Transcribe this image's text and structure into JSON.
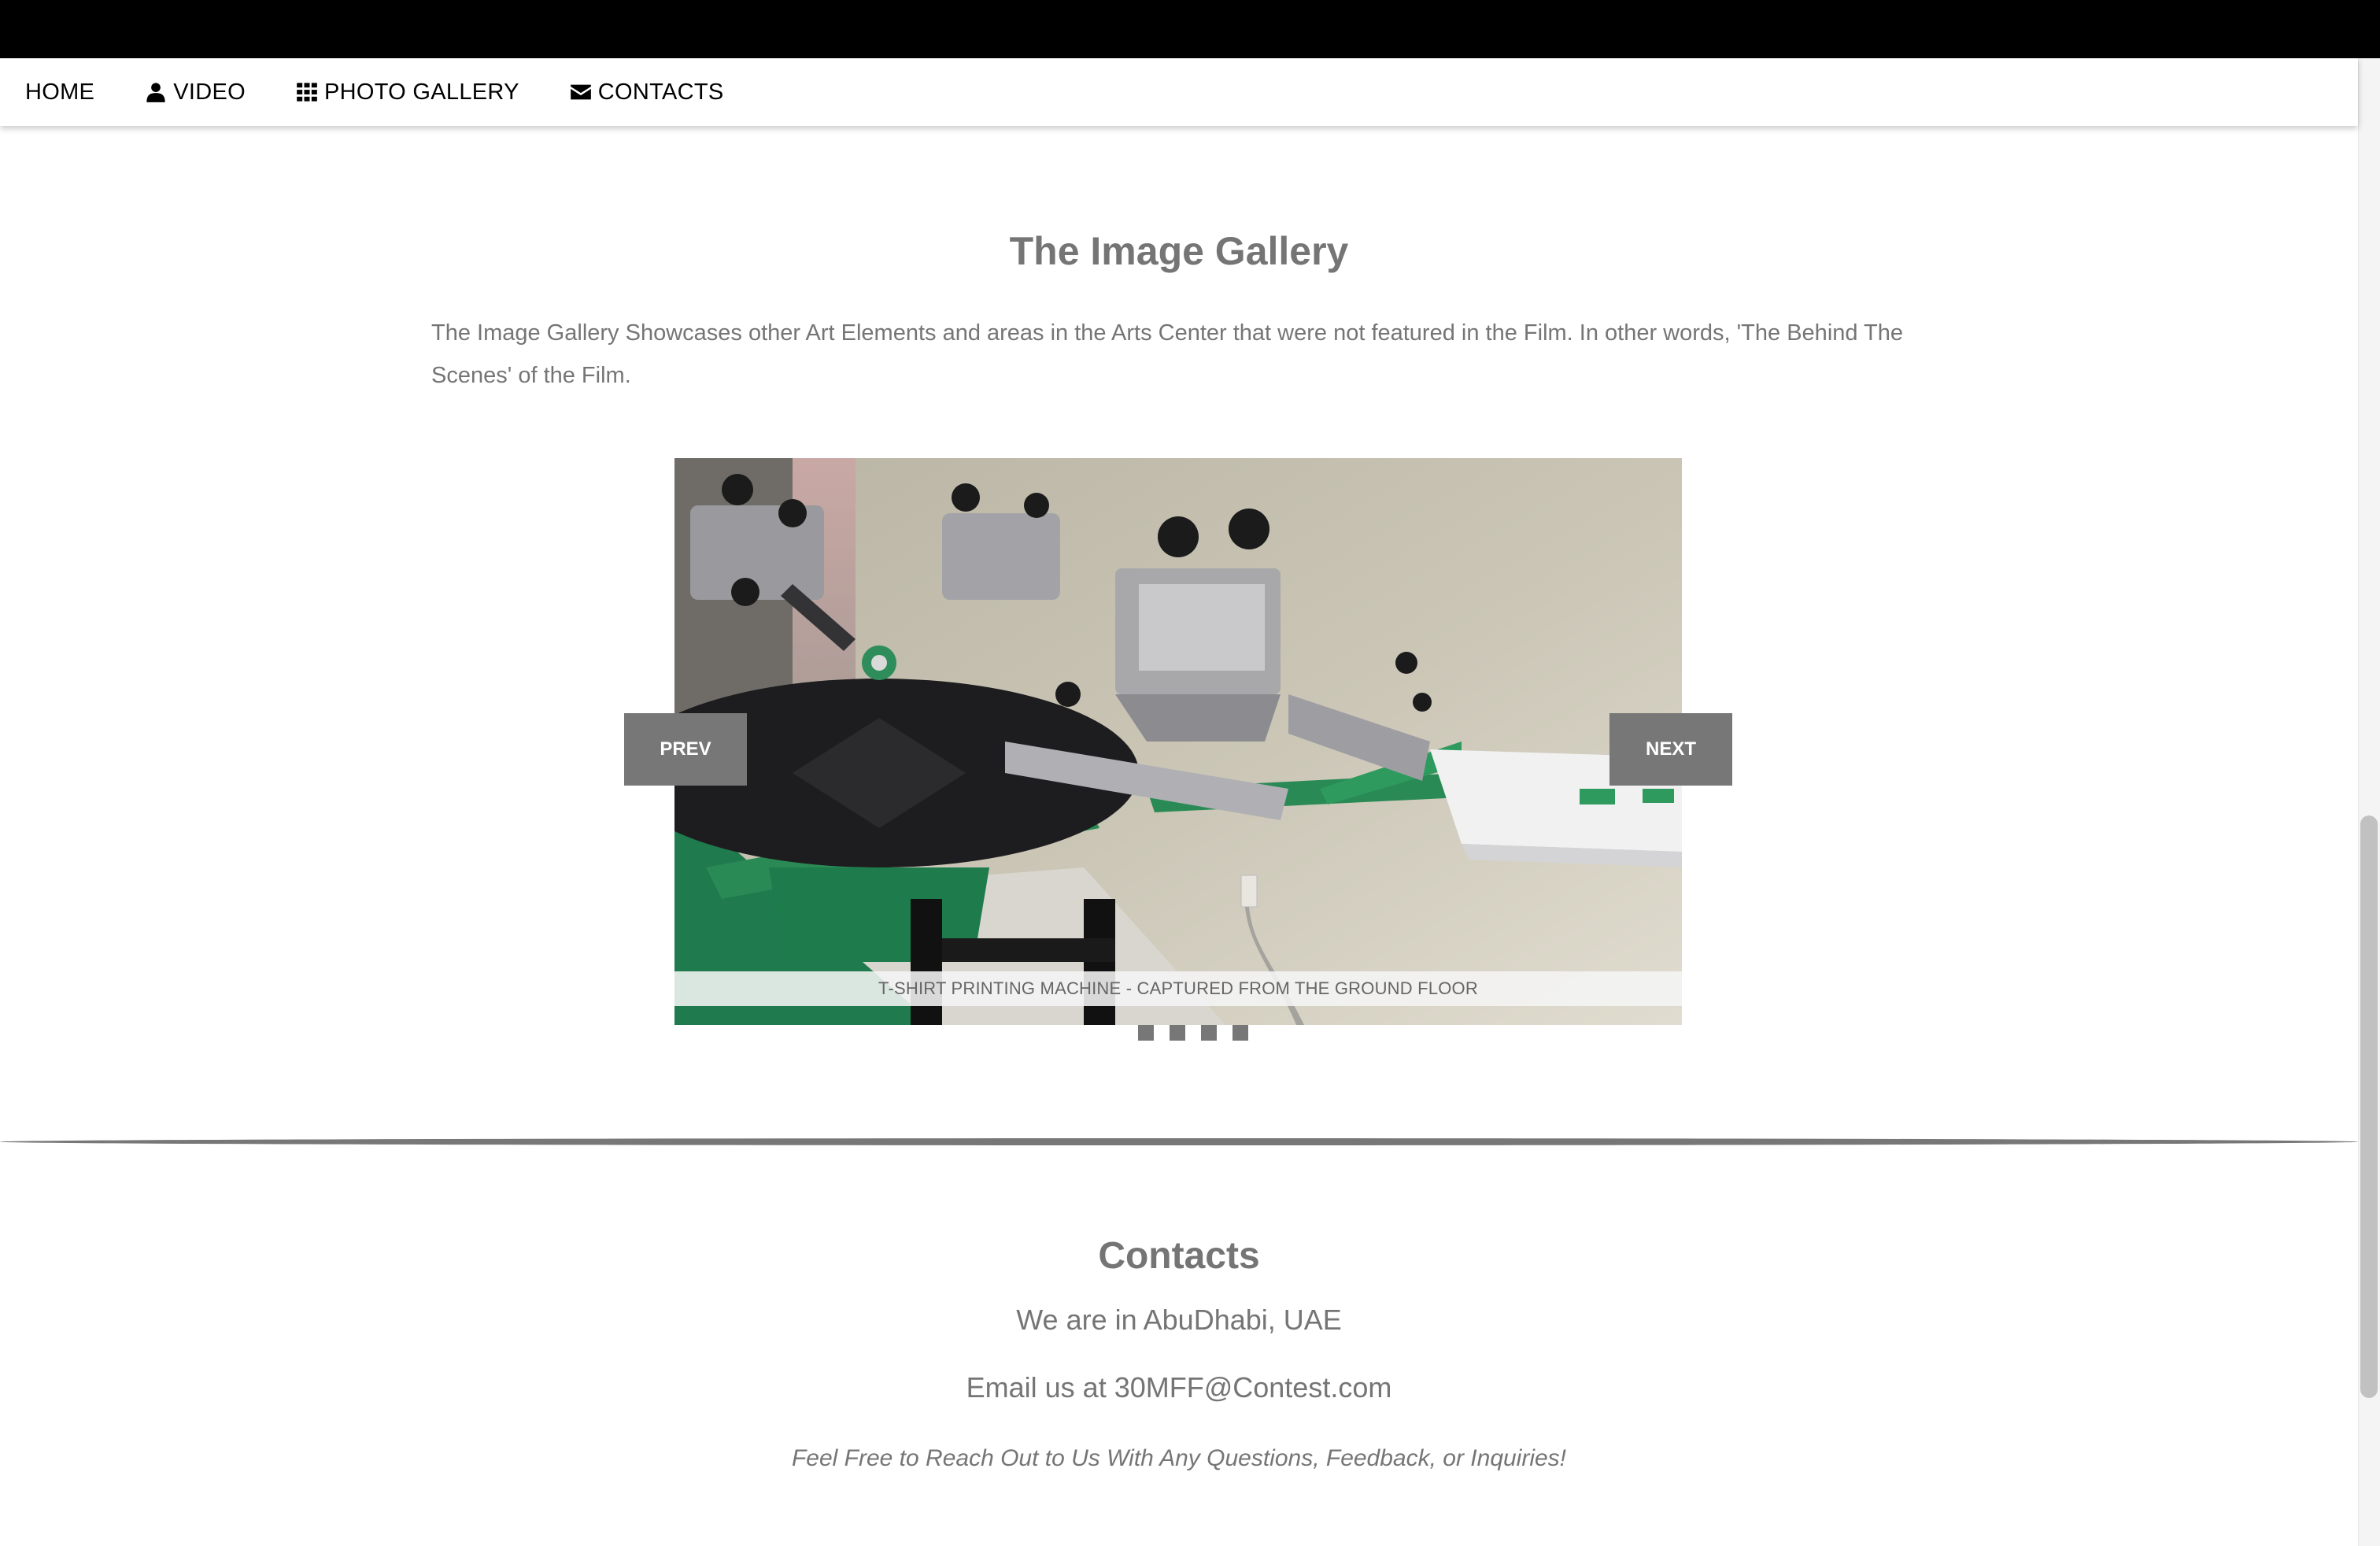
{
  "nav": {
    "items": [
      {
        "label": "HOME",
        "icon": ""
      },
      {
        "label": "VIDEO",
        "icon": "user-icon"
      },
      {
        "label": "PHOTO GALLERY",
        "icon": "grid-icon"
      },
      {
        "label": "CONTACTS",
        "icon": "envelope-icon"
      }
    ]
  },
  "gallery": {
    "title": "The Image Gallery",
    "description": "The Image Gallery Showcases other Art Elements and areas in the Arts Center that were not featured in the Film. In other words, 'The Behind The Scenes' of the Film.",
    "caption": "T-SHIRT PRINTING MACHINE - CAPTURED FROM THE GROUND FLOOR",
    "prev_label": "PREV",
    "next_label": "NEXT",
    "slide_count": 4
  },
  "contacts": {
    "title": "Contacts",
    "location": "We are in AbuDhabi, UAE",
    "email": "Email us at 30MFF@Contest.com",
    "note": "Feel Free to Reach Out to Us With Any Questions, Feedback, or Inquiries!"
  }
}
